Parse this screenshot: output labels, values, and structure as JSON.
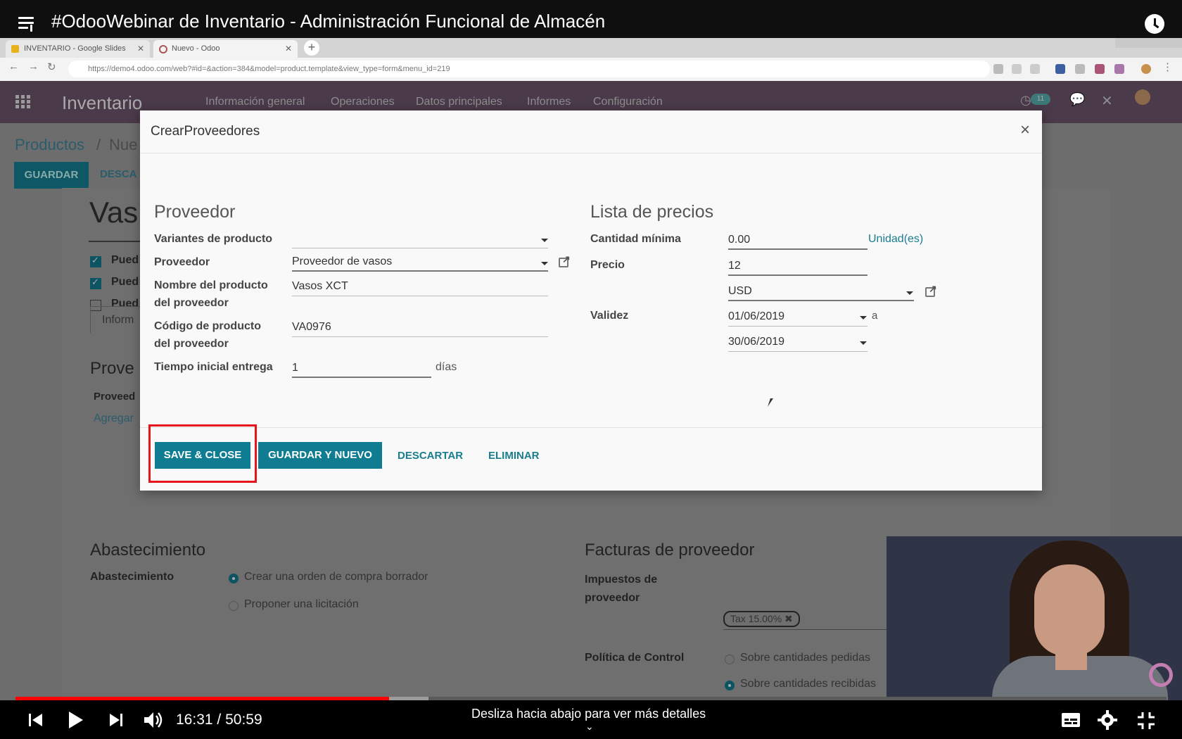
{
  "youtube": {
    "title": "#OdooWebinar de Inventario - Administración Funcional de Almacén",
    "time_current": "16:31",
    "time_separator": "/",
    "time_total": "50:59",
    "scroll_hint": "Desliza hacia abajo para ver más detalles",
    "progress_fraction": 0.3245,
    "buffer_fraction": 0.359,
    "accent_color": "#ff0000"
  },
  "browser": {
    "tabs": [
      {
        "label": "INVENTARIO - Google Slides"
      },
      {
        "label": "Nuevo - Odoo"
      }
    ],
    "new_tab": "+",
    "url": "https://demo4.odoo.com/web?#id=&action=384&model=product.template&view_type=form&menu_id=219"
  },
  "odoo": {
    "app_name": "Inventario",
    "menu": [
      "Información general",
      "Operaciones",
      "Datos principales",
      "Informes",
      "Configuración"
    ],
    "activity_count": "11",
    "breadcrumb": {
      "root": "Productos",
      "sep": "/",
      "current": "Nue"
    },
    "save_button": "GUARDAR",
    "discard_button": "DESCA",
    "product_name": "Vas",
    "checks": [
      "Pued",
      "Pued",
      "Pued"
    ],
    "tab_info": "Inform",
    "vendors_section": "Prove",
    "vendors_col": "Proveed",
    "add_line": "Agregar",
    "procurement": {
      "title": "Abastecimiento",
      "label": "Abastecimiento",
      "options": [
        "Crear una orden de compra borrador",
        "Proponer una licitación"
      ]
    },
    "vendor_bills": {
      "title": "Facturas de proveedor",
      "taxes_label": "Impuestos de proveedor",
      "tax_tag": "Tax 15.00% ✖",
      "control_label": "Política de Control",
      "control_options": [
        "Sobre cantidades pedidas",
        "Sobre cantidades recibidas"
      ]
    }
  },
  "modal": {
    "title": "CrearProveedores",
    "close": "×",
    "vendor_section": "Proveedor",
    "pricelist_section": "Lista de precios",
    "fields": {
      "variants_label": "Variantes de producto",
      "variants_value": "",
      "vendor_label": "Proveedor",
      "vendor_value": "Proveedor de vasos",
      "vendor_product_name_label_1": "Nombre del producto",
      "vendor_product_name_label_2": "del proveedor",
      "vendor_product_name_value": "Vasos XCT",
      "vendor_product_code_label_1": "Código de producto",
      "vendor_product_code_label_2": "del proveedor",
      "vendor_product_code_value": "VA0976",
      "lead_time_label": "Tiempo inicial entrega",
      "lead_time_value": "1",
      "lead_time_unit": "días",
      "min_qty_label": "Cantidad mínima",
      "min_qty_value": "0.00",
      "min_qty_unit": "Unidad(es)",
      "price_label": "Precio",
      "price_value": "12",
      "currency_value": "USD",
      "validity_label": "Validez",
      "date_start": "01/06/2019",
      "date_to": "a",
      "date_end": "30/06/2019"
    },
    "buttons": {
      "save_close": "SAVE & CLOSE",
      "save_new": "GUARDAR Y NUEVO",
      "discard": "DESCARTAR",
      "delete": "ELIMINAR"
    },
    "primary_color": "#0f7c92",
    "highlight_color": "#e8141c"
  }
}
